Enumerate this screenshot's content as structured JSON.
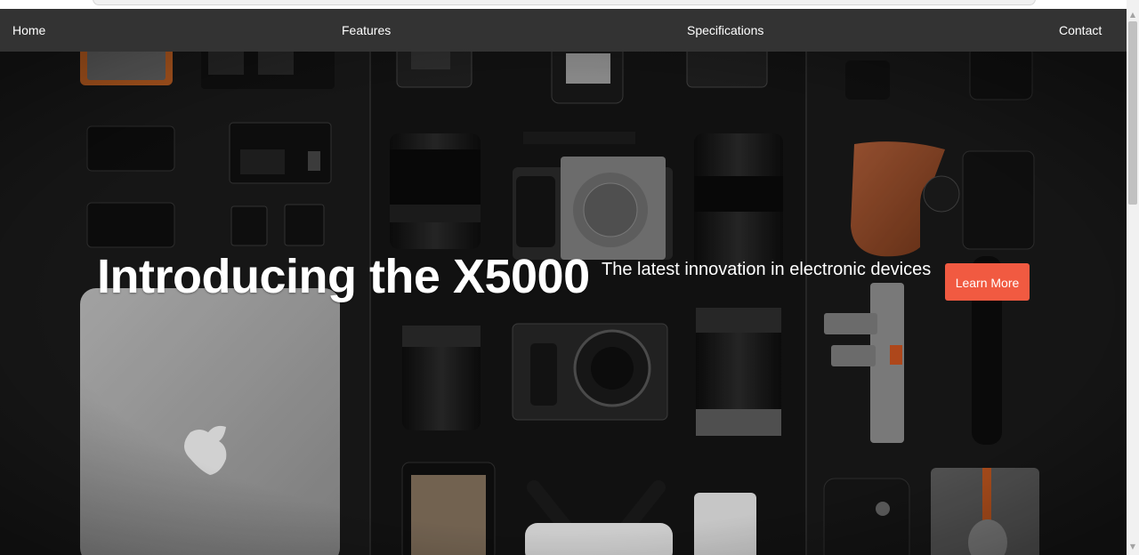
{
  "nav": {
    "items": [
      {
        "label": "Home"
      },
      {
        "label": "Features"
      },
      {
        "label": "Specifications"
      },
      {
        "label": "Contact"
      }
    ]
  },
  "hero": {
    "title": "Introducing the X5000",
    "subtitle": "The latest innovation in electronic devices",
    "cta_label": "Learn More"
  },
  "colors": {
    "navbar": "#333333",
    "cta": "#f15a41",
    "text": "#ffffff"
  }
}
